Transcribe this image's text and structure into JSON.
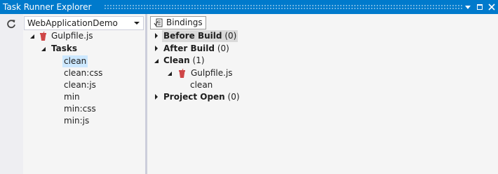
{
  "window": {
    "title": "Task Runner Explorer"
  },
  "left": {
    "project_select": {
      "value": "WebApplicationDemo"
    },
    "tree": {
      "file": "Gulpfile.js",
      "tasks_label": "Tasks",
      "tasks": [
        "clean",
        "clean:css",
        "clean:js",
        "min",
        "min:css",
        "min:js"
      ],
      "selected_task": "clean"
    }
  },
  "right": {
    "tab_label": "Bindings",
    "bindings": [
      {
        "name": "Before Build",
        "count": "(0)"
      },
      {
        "name": "After Build",
        "count": "(0)"
      },
      {
        "name": "Clean",
        "count": "(1)",
        "file": "Gulpfile.js",
        "task": "clean"
      },
      {
        "name": "Project Open",
        "count": "(0)"
      }
    ]
  },
  "colors": {
    "accent": "#007acc",
    "selection": "#cce8ff",
    "gulp_red": "#cf4647"
  },
  "icons": [
    "refresh-icon",
    "gulp-cup-icon",
    "bindings-icon",
    "dropdown-arrow-icon",
    "maximize-icon",
    "close-icon"
  ]
}
